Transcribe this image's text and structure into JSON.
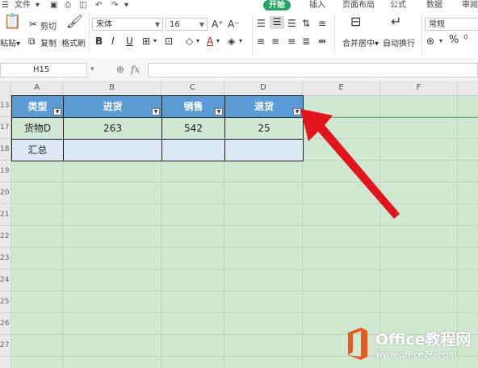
{
  "menubar": {
    "file_label": "文件",
    "tabs": [
      {
        "label": "开始",
        "active": true
      },
      {
        "label": "插入",
        "active": false
      },
      {
        "label": "页面布局",
        "active": false
      },
      {
        "label": "公式",
        "active": false
      },
      {
        "label": "数据",
        "active": false
      },
      {
        "label": "审阅",
        "active": false
      }
    ]
  },
  "ribbon": {
    "paste_label": "粘贴",
    "cut_label": "剪切",
    "copy_label": "复制",
    "format_painter_label": "格式刷",
    "font_name": "宋体",
    "font_size": "16",
    "merge_center_label": "合并居中",
    "wrap_text_label": "自动换行",
    "number_format": "常规",
    "bold": "B",
    "italic": "I",
    "underline": "U",
    "font_color_letter": "A"
  },
  "formula_bar": {
    "name_box": "H15",
    "fx_label": "fx",
    "formula": ""
  },
  "columns": [
    "A",
    "B",
    "C",
    "D",
    "E",
    "F"
  ],
  "rows": [
    "13",
    "17",
    "18",
    "19",
    "20",
    "21",
    "22",
    "23",
    "24",
    "25",
    "26",
    "27"
  ],
  "table": {
    "headers": [
      "类型",
      "进货",
      "销售",
      "退货"
    ],
    "rows": [
      [
        "货物D",
        "263",
        "542",
        "25"
      ],
      [
        "汇总",
        "",
        "",
        ""
      ]
    ]
  },
  "watermark": {
    "brand": "Office教程网",
    "url": "www.office26.com"
  },
  "colors": {
    "sheet_bg": "#d0e8d2",
    "header_fill": "#5b9bd5",
    "total_fill": "#dce9f5",
    "accent_tab": "#21a464",
    "arrow": "#e3141b"
  }
}
